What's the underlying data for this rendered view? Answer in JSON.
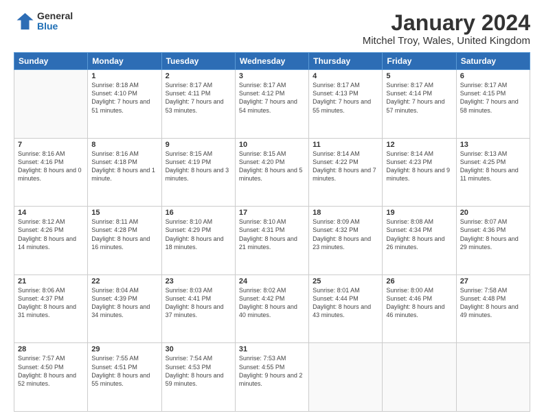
{
  "logo": {
    "general": "General",
    "blue": "Blue"
  },
  "title": "January 2024",
  "subtitle": "Mitchel Troy, Wales, United Kingdom",
  "days_header": [
    "Sunday",
    "Monday",
    "Tuesday",
    "Wednesday",
    "Thursday",
    "Friday",
    "Saturday"
  ],
  "weeks": [
    [
      {
        "num": "",
        "sunrise": "",
        "sunset": "",
        "daylight": ""
      },
      {
        "num": "1",
        "sunrise": "Sunrise: 8:18 AM",
        "sunset": "Sunset: 4:10 PM",
        "daylight": "Daylight: 7 hours and 51 minutes."
      },
      {
        "num": "2",
        "sunrise": "Sunrise: 8:17 AM",
        "sunset": "Sunset: 4:11 PM",
        "daylight": "Daylight: 7 hours and 53 minutes."
      },
      {
        "num": "3",
        "sunrise": "Sunrise: 8:17 AM",
        "sunset": "Sunset: 4:12 PM",
        "daylight": "Daylight: 7 hours and 54 minutes."
      },
      {
        "num": "4",
        "sunrise": "Sunrise: 8:17 AM",
        "sunset": "Sunset: 4:13 PM",
        "daylight": "Daylight: 7 hours and 55 minutes."
      },
      {
        "num": "5",
        "sunrise": "Sunrise: 8:17 AM",
        "sunset": "Sunset: 4:14 PM",
        "daylight": "Daylight: 7 hours and 57 minutes."
      },
      {
        "num": "6",
        "sunrise": "Sunrise: 8:17 AM",
        "sunset": "Sunset: 4:15 PM",
        "daylight": "Daylight: 7 hours and 58 minutes."
      }
    ],
    [
      {
        "num": "7",
        "sunrise": "Sunrise: 8:16 AM",
        "sunset": "Sunset: 4:16 PM",
        "daylight": "Daylight: 8 hours and 0 minutes."
      },
      {
        "num": "8",
        "sunrise": "Sunrise: 8:16 AM",
        "sunset": "Sunset: 4:18 PM",
        "daylight": "Daylight: 8 hours and 1 minute."
      },
      {
        "num": "9",
        "sunrise": "Sunrise: 8:15 AM",
        "sunset": "Sunset: 4:19 PM",
        "daylight": "Daylight: 8 hours and 3 minutes."
      },
      {
        "num": "10",
        "sunrise": "Sunrise: 8:15 AM",
        "sunset": "Sunset: 4:20 PM",
        "daylight": "Daylight: 8 hours and 5 minutes."
      },
      {
        "num": "11",
        "sunrise": "Sunrise: 8:14 AM",
        "sunset": "Sunset: 4:22 PM",
        "daylight": "Daylight: 8 hours and 7 minutes."
      },
      {
        "num": "12",
        "sunrise": "Sunrise: 8:14 AM",
        "sunset": "Sunset: 4:23 PM",
        "daylight": "Daylight: 8 hours and 9 minutes."
      },
      {
        "num": "13",
        "sunrise": "Sunrise: 8:13 AM",
        "sunset": "Sunset: 4:25 PM",
        "daylight": "Daylight: 8 hours and 11 minutes."
      }
    ],
    [
      {
        "num": "14",
        "sunrise": "Sunrise: 8:12 AM",
        "sunset": "Sunset: 4:26 PM",
        "daylight": "Daylight: 8 hours and 14 minutes."
      },
      {
        "num": "15",
        "sunrise": "Sunrise: 8:11 AM",
        "sunset": "Sunset: 4:28 PM",
        "daylight": "Daylight: 8 hours and 16 minutes."
      },
      {
        "num": "16",
        "sunrise": "Sunrise: 8:10 AM",
        "sunset": "Sunset: 4:29 PM",
        "daylight": "Daylight: 8 hours and 18 minutes."
      },
      {
        "num": "17",
        "sunrise": "Sunrise: 8:10 AM",
        "sunset": "Sunset: 4:31 PM",
        "daylight": "Daylight: 8 hours and 21 minutes."
      },
      {
        "num": "18",
        "sunrise": "Sunrise: 8:09 AM",
        "sunset": "Sunset: 4:32 PM",
        "daylight": "Daylight: 8 hours and 23 minutes."
      },
      {
        "num": "19",
        "sunrise": "Sunrise: 8:08 AM",
        "sunset": "Sunset: 4:34 PM",
        "daylight": "Daylight: 8 hours and 26 minutes."
      },
      {
        "num": "20",
        "sunrise": "Sunrise: 8:07 AM",
        "sunset": "Sunset: 4:36 PM",
        "daylight": "Daylight: 8 hours and 29 minutes."
      }
    ],
    [
      {
        "num": "21",
        "sunrise": "Sunrise: 8:06 AM",
        "sunset": "Sunset: 4:37 PM",
        "daylight": "Daylight: 8 hours and 31 minutes."
      },
      {
        "num": "22",
        "sunrise": "Sunrise: 8:04 AM",
        "sunset": "Sunset: 4:39 PM",
        "daylight": "Daylight: 8 hours and 34 minutes."
      },
      {
        "num": "23",
        "sunrise": "Sunrise: 8:03 AM",
        "sunset": "Sunset: 4:41 PM",
        "daylight": "Daylight: 8 hours and 37 minutes."
      },
      {
        "num": "24",
        "sunrise": "Sunrise: 8:02 AM",
        "sunset": "Sunset: 4:42 PM",
        "daylight": "Daylight: 8 hours and 40 minutes."
      },
      {
        "num": "25",
        "sunrise": "Sunrise: 8:01 AM",
        "sunset": "Sunset: 4:44 PM",
        "daylight": "Daylight: 8 hours and 43 minutes."
      },
      {
        "num": "26",
        "sunrise": "Sunrise: 8:00 AM",
        "sunset": "Sunset: 4:46 PM",
        "daylight": "Daylight: 8 hours and 46 minutes."
      },
      {
        "num": "27",
        "sunrise": "Sunrise: 7:58 AM",
        "sunset": "Sunset: 4:48 PM",
        "daylight": "Daylight: 8 hours and 49 minutes."
      }
    ],
    [
      {
        "num": "28",
        "sunrise": "Sunrise: 7:57 AM",
        "sunset": "Sunset: 4:50 PM",
        "daylight": "Daylight: 8 hours and 52 minutes."
      },
      {
        "num": "29",
        "sunrise": "Sunrise: 7:55 AM",
        "sunset": "Sunset: 4:51 PM",
        "daylight": "Daylight: 8 hours and 55 minutes."
      },
      {
        "num": "30",
        "sunrise": "Sunrise: 7:54 AM",
        "sunset": "Sunset: 4:53 PM",
        "daylight": "Daylight: 8 hours and 59 minutes."
      },
      {
        "num": "31",
        "sunrise": "Sunrise: 7:53 AM",
        "sunset": "Sunset: 4:55 PM",
        "daylight": "Daylight: 9 hours and 2 minutes."
      },
      {
        "num": "",
        "sunrise": "",
        "sunset": "",
        "daylight": ""
      },
      {
        "num": "",
        "sunrise": "",
        "sunset": "",
        "daylight": ""
      },
      {
        "num": "",
        "sunrise": "",
        "sunset": "",
        "daylight": ""
      }
    ]
  ]
}
